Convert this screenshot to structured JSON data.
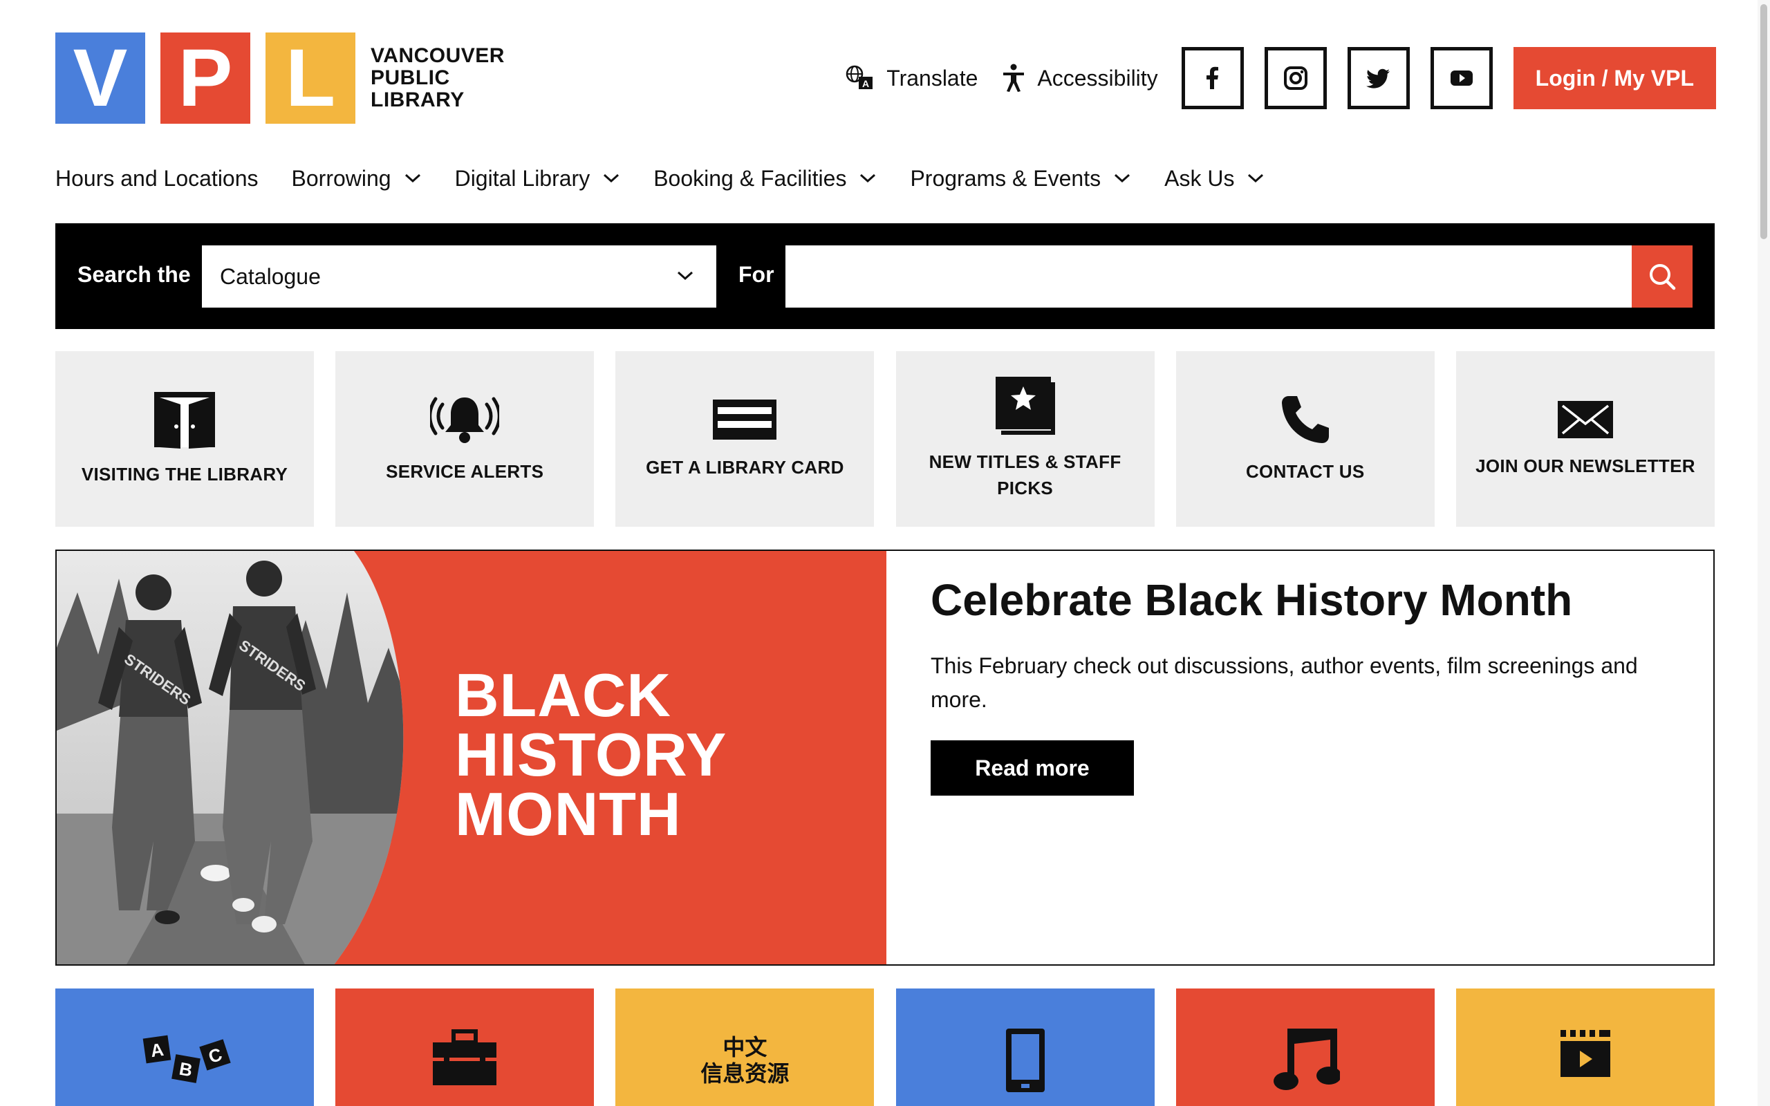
{
  "colors": {
    "brand_blue": "#4a7fdb",
    "brand_red": "#e54a33",
    "brand_yellow": "#f3b63f",
    "black": "#000000",
    "tile_gray": "#eeeeee"
  },
  "logo": {
    "letters": [
      "V",
      "P",
      "L"
    ],
    "name_lines": [
      "VANCOUVER",
      "PUBLIC",
      "LIBRARY"
    ]
  },
  "header": {
    "translate_label": "Translate",
    "translate_icon": "translate-icon",
    "accessibility_label": "Accessibility",
    "accessibility_icon": "accessibility-icon",
    "social_icons": [
      "facebook-icon",
      "instagram-icon",
      "twitter-icon",
      "youtube-icon"
    ],
    "login_label": "Login / My VPL"
  },
  "nav": {
    "items": [
      {
        "label": "Hours and Locations",
        "has_dropdown": false
      },
      {
        "label": "Borrowing",
        "has_dropdown": true
      },
      {
        "label": "Digital Library",
        "has_dropdown": true
      },
      {
        "label": "Booking & Facilities",
        "has_dropdown": true
      },
      {
        "label": "Programs & Events",
        "has_dropdown": true
      },
      {
        "label": "Ask Us",
        "has_dropdown": true
      }
    ]
  },
  "search": {
    "label_prefix": "Search the",
    "scope_value": "Catalogue",
    "label_for": "For",
    "query_value": "",
    "button_icon": "search-icon"
  },
  "quick_links": [
    {
      "label": "VISITING THE LIBRARY",
      "icon": "door-icon"
    },
    {
      "label": "SERVICE ALERTS",
      "icon": "bell-alert-icon"
    },
    {
      "label": "GET A LIBRARY CARD",
      "icon": "library-card-icon"
    },
    {
      "label": "NEW TITLES & STAFF PICKS",
      "icon": "book-star-icon"
    },
    {
      "label": "CONTACT US",
      "icon": "phone-icon"
    },
    {
      "label": "JOIN OUR NEWSLETTER",
      "icon": "envelope-icon"
    }
  ],
  "feature": {
    "banner_lines": [
      "BLACK",
      "HISTORY",
      "MONTH"
    ],
    "photo_label": "STRIDERS",
    "title": "Celebrate Black History Month",
    "description": "This February check out discussions, author events, film screenings and more.",
    "button_label": "Read more"
  },
  "category_tiles": [
    {
      "color": "blue",
      "icon": "abc-blocks-icon",
      "letters": [
        "A",
        "B",
        "C"
      ]
    },
    {
      "color": "red",
      "icon": "toolbox-icon"
    },
    {
      "color": "yellow",
      "icon": "chinese-text-icon",
      "lines": [
        "中文",
        "信息资源"
      ]
    },
    {
      "color": "blue",
      "icon": "mobile-phone-icon"
    },
    {
      "color": "red",
      "icon": "music-note-icon"
    },
    {
      "color": "yellow",
      "icon": "film-clapper-icon"
    }
  ]
}
